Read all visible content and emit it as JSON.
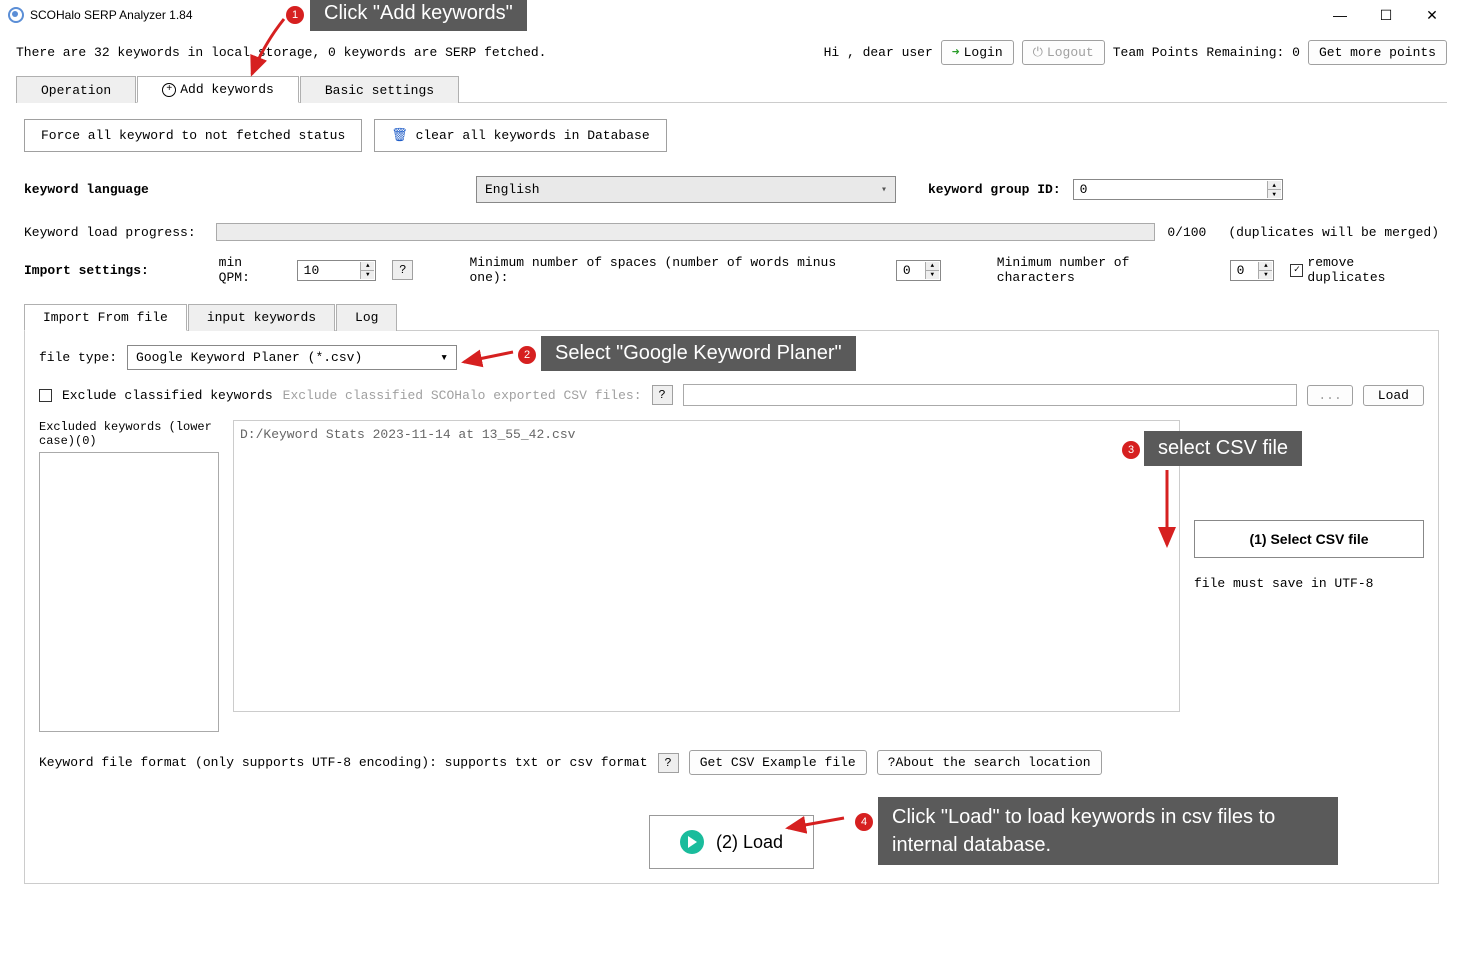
{
  "window": {
    "title": "SCOHalo SERP Analyzer 1.84",
    "minimize": "—",
    "maximize": "☐",
    "close": "✕"
  },
  "status": {
    "left_text": "There are 32 keywords in local storage, 0 keywords are SERP fetched.",
    "greeting": "Hi , dear user",
    "login_label": "Login",
    "logout_label": "Logout",
    "points_label": "Team Points Remaining: 0",
    "more_points_label": "Get more points"
  },
  "tabs": {
    "operation": "Operation",
    "add_keywords": "Add keywords",
    "basic_settings": "Basic settings"
  },
  "buttons": {
    "force_not_fetched": "Force all keyword to not fetched status",
    "clear_all": "clear all keywords in Database"
  },
  "language": {
    "label": "keyword language",
    "value": "English",
    "group_label": "keyword group ID:",
    "group_value": "0"
  },
  "progress": {
    "label": "Keyword load progress:",
    "value": "0/100",
    "note": "(duplicates will be merged)"
  },
  "import": {
    "label": "Import settings:",
    "min_qpm_label": "min QPM:",
    "min_qpm_value": "10",
    "help": "?",
    "spaces_label": "Minimum number of spaces (number of words minus one):",
    "spaces_value": "0",
    "chars_label": "Minimum number of characters",
    "chars_value": "0",
    "remove_dup_label": "remove duplicates",
    "remove_dup_checked": true
  },
  "subtabs": {
    "import_file": "Import From file",
    "input_keywords": "input keywords",
    "log": "Log"
  },
  "filetype": {
    "label": "file type:",
    "value": "Google Keyword Planer (*.csv)"
  },
  "exclude": {
    "checkbox_label": "Exclude classified keywords",
    "gray_label": "Exclude classified SCOHalo exported CSV files:",
    "help": "?",
    "browse": "...",
    "load": "Load"
  },
  "excluded_panel": {
    "label": "Excluded keywords (lower case)(0)"
  },
  "filepath": "D:/Keyword Stats 2023-11-14 at 13_55_42.csv",
  "side": {
    "select_btn": "(1) Select CSV file",
    "note": "file must save in UTF-8"
  },
  "format": {
    "text": "Keyword file format (only supports UTF-8 encoding): supports txt or csv format",
    "help": "?",
    "example_btn": "Get CSV Example file",
    "about_btn": "?About the search location"
  },
  "load_btn": "(2) Load",
  "ann": {
    "c1": "Click \"Add keywords\"",
    "c2": "Select \"Google Keyword Planer\"",
    "c3": "select CSV file",
    "c4": "Click \"Load\" to load keywords in csv files to internal database."
  }
}
